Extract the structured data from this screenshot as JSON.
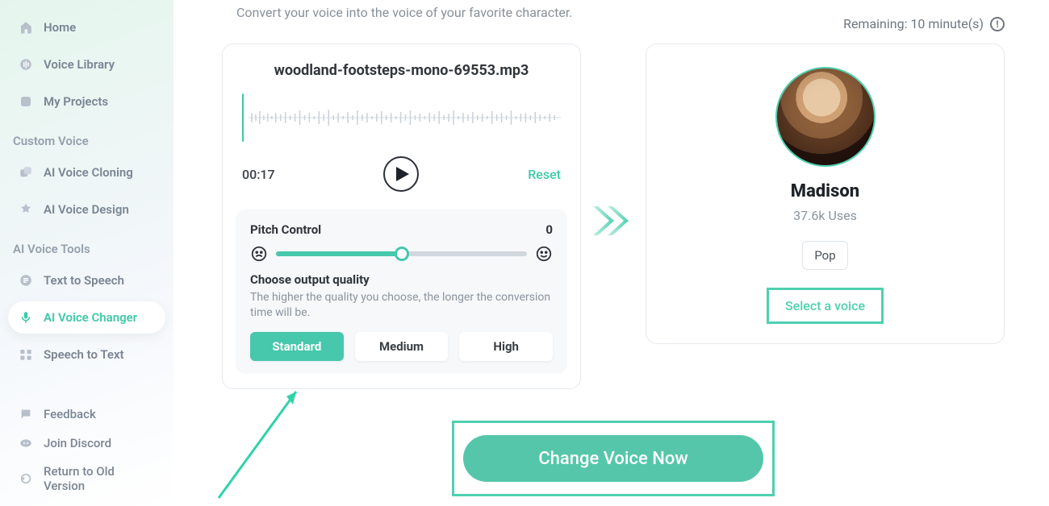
{
  "sidebar": {
    "items": [
      {
        "label": "Home"
      },
      {
        "label": "Voice Library"
      },
      {
        "label": "My Projects"
      }
    ],
    "section_custom": "Custom Voice",
    "custom_items": [
      {
        "label": "AI Voice Cloning"
      },
      {
        "label": "AI Voice Design"
      }
    ],
    "section_tools": "AI Voice Tools",
    "tool_items": [
      {
        "label": "Text to Speech"
      },
      {
        "label": "AI Voice Changer"
      },
      {
        "label": "Speech to Text"
      }
    ],
    "footer": [
      {
        "label": "Feedback"
      },
      {
        "label": "Join Discord"
      },
      {
        "label": "Return to Old Version"
      }
    ]
  },
  "header": {
    "subtitle": "Convert your voice into the voice of your favorite character.",
    "remaining": "Remaining: 10 minute(s)"
  },
  "source": {
    "filename": "woodland-footsteps-mono-69553.mp3",
    "timecode": "00:17",
    "reset": "Reset",
    "pitch_label": "Pitch Control",
    "pitch_value": "0",
    "quality_title": "Choose output quality",
    "quality_hint": "The higher the quality you choose, the longer the conversion time will be.",
    "quality_options": [
      "Standard",
      "Medium",
      "High"
    ],
    "quality_selected_index": 0,
    "slider_percent": 50
  },
  "voice": {
    "name": "Madison",
    "uses": "37.6k Uses",
    "tag": "Pop",
    "select_label": "Select a voice"
  },
  "cta": {
    "label": "Change Voice Now"
  }
}
